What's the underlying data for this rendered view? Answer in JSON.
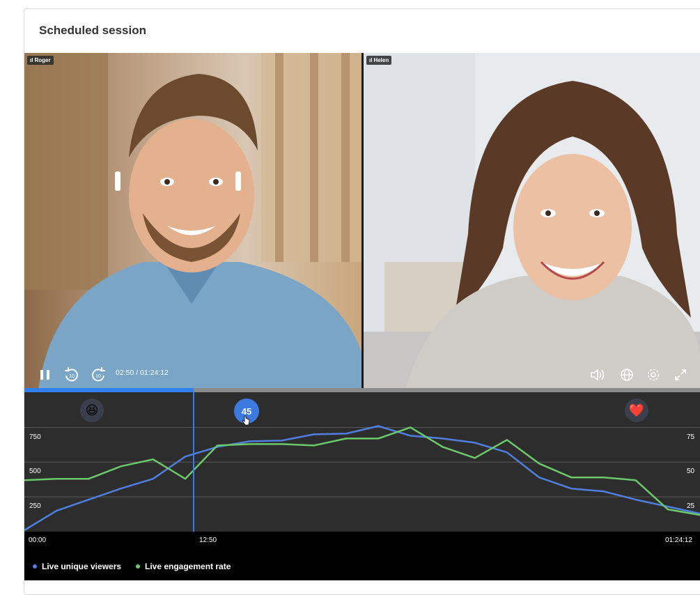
{
  "page": {
    "title": "Scheduled session"
  },
  "participants": [
    {
      "name": "Roger"
    },
    {
      "name": "Helen"
    }
  ],
  "player": {
    "time": "02:50 / 01:24:12",
    "progress_fraction": 0.25,
    "icons": {
      "pause": "pause-icon",
      "rewind": "rewind-10-icon",
      "forward": "forward-10-icon",
      "volume": "volume-icon",
      "language": "globe-icon",
      "settings": "gear-icon",
      "fullscreen": "fullscreen-icon"
    },
    "rewind_label": "10",
    "forward_label": "10"
  },
  "timeline": {
    "badge_value": "45",
    "cursor_label": "12:50",
    "reactions": [
      "heart-eyes-smile-icon",
      "heart-hand-icon"
    ],
    "start_label": "00:00",
    "end_label": "01:24:12"
  },
  "chart_data": {
    "type": "line",
    "x": [
      0,
      1,
      2,
      3,
      4,
      5,
      6,
      7,
      8,
      9,
      10,
      11,
      12,
      13,
      14,
      15,
      16,
      17,
      18,
      19,
      20,
      21
    ],
    "left_axis": {
      "ticks": [
        "250",
        "500",
        "750"
      ],
      "ylim": [
        0,
        1000
      ]
    },
    "right_axis": {
      "ticks": [
        "25",
        "50",
        "75"
      ],
      "ylim": [
        0,
        100
      ]
    },
    "series": [
      {
        "name": "Live unique viewers",
        "color": "#4f7fe0",
        "values": [
          10,
          150,
          230,
          310,
          380,
          540,
          610,
          650,
          655,
          700,
          705,
          760,
          690,
          670,
          640,
          570,
          390,
          310,
          290,
          230,
          180,
          130
        ]
      },
      {
        "name": "Live engagement rate",
        "color": "#6cc96b",
        "values": [
          37,
          38,
          38,
          47,
          52,
          38,
          62,
          63,
          63,
          62,
          67,
          67,
          75,
          61,
          53,
          66,
          49,
          39,
          39,
          37,
          16,
          12
        ]
      }
    ],
    "grid": true
  },
  "legend": {
    "items": [
      {
        "label": "Live unique viewers",
        "color": "#4f7fe0"
      },
      {
        "label": "Live engagement rate",
        "color": "#6cc96b"
      }
    ]
  }
}
